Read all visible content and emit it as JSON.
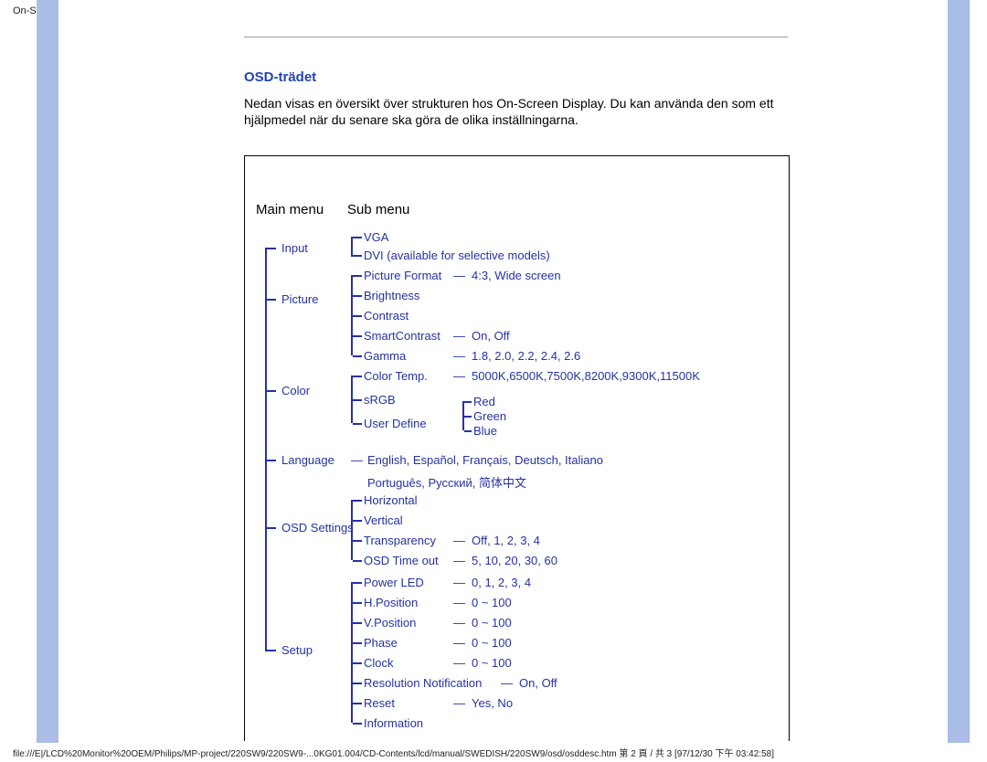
{
  "browser": {
    "title": "On-Screen Display"
  },
  "section": {
    "title": "OSD-trädet",
    "intro_1": "Nedan visas en översikt över strukturen hos On-Screen Display. Du kan använda den som ett",
    "intro_2": "hjälpmedel när du senare ska göra de olika inställningarna."
  },
  "headers": {
    "main": "Main menu",
    "sub": "Sub menu"
  },
  "main_items": {
    "input": "Input",
    "picture": "Picture",
    "color": "Color",
    "language": "Language",
    "osd_settings": "OSD Settings",
    "setup": "Setup"
  },
  "sub": {
    "input": {
      "vga": "VGA",
      "dvi": "DVI (available for selective models)"
    },
    "picture": {
      "picture_format": "Picture Format",
      "picture_format_vals": "4:3, Wide screen",
      "brightness": "Brightness",
      "contrast": "Contrast",
      "smartcontrast": "SmartContrast",
      "smartcontrast_vals": "On, Off",
      "gamma": "Gamma",
      "gamma_vals": "1.8, 2.0, 2.2, 2.4, 2.6"
    },
    "color": {
      "color_temp": "Color Temp.",
      "color_temp_vals": "5000K,6500K,7500K,8200K,9300K,11500K",
      "srgb": "sRGB",
      "user_define": "User Define",
      "red": "Red",
      "green": "Green",
      "blue": "Blue"
    },
    "language": {
      "line1": "English, Español, Français, Deutsch, Italiano",
      "line2": "Português, Русский, 简体中文"
    },
    "osd": {
      "horizontal": "Horizontal",
      "vertical": "Vertical",
      "transparency": "Transparency",
      "transparency_vals": "Off, 1, 2, 3, 4",
      "time_out": "OSD Time out",
      "time_out_vals": "5, 10, 20, 30, 60"
    },
    "setup": {
      "power_led": "Power LED",
      "power_led_vals": "0, 1, 2, 3, 4",
      "hpos": "H.Position",
      "hpos_vals": "0 ~ 100",
      "vpos": "V.Position",
      "vpos_vals": "0 ~ 100",
      "phase": "Phase",
      "phase_vals": "0 ~ 100",
      "clock": "Clock",
      "clock_vals": "0 ~ 100",
      "res_notif": "Resolution Notification",
      "res_notif_vals": "On, Off",
      "reset": "Reset",
      "reset_vals": "Yes, No",
      "information": "Information"
    }
  },
  "dash": "—",
  "footer": {
    "path": "file:///E|/LCD%20Monitor%20OEM/Philips/MP-project/220SW9/220SW9-...0KG01.004/CD-Contents/lcd/manual/SWEDISH/220SW9/osd/osddesc.htm 第 2 頁 / 共 3  [97/12/30 下午 03:42:58]"
  }
}
